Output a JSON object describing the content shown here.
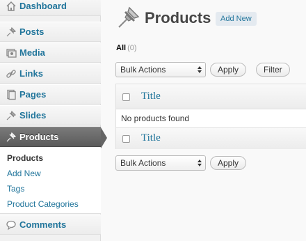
{
  "sidebar": {
    "items": [
      {
        "label": "Dashboard",
        "icon": "dashboard-icon"
      },
      {
        "label": "Posts",
        "icon": "pushpin-icon"
      },
      {
        "label": "Media",
        "icon": "media-icon"
      },
      {
        "label": "Links",
        "icon": "link-icon"
      },
      {
        "label": "Pages",
        "icon": "pages-icon"
      },
      {
        "label": "Slides",
        "icon": "pushpin-icon"
      },
      {
        "label": "Products",
        "icon": "pushpin-icon",
        "current": true
      },
      {
        "label": "Comments",
        "icon": "comment-icon"
      }
    ],
    "submenu": [
      "Products",
      "Add New",
      "Tags",
      "Product Categories"
    ]
  },
  "main": {
    "title": "Products",
    "add_new": "Add New",
    "filter_all": "All",
    "filter_count": "(0)",
    "bulk_actions_top": "Bulk Actions",
    "apply_top": "Apply",
    "filter_button": "Filter",
    "table": {
      "column_title": "Title",
      "empty_message": "No products found"
    },
    "bulk_actions_bottom": "Bulk Actions",
    "apply_bottom": "Apply"
  },
  "colors": {
    "link": "#21759b",
    "current_menu": "#656565"
  }
}
